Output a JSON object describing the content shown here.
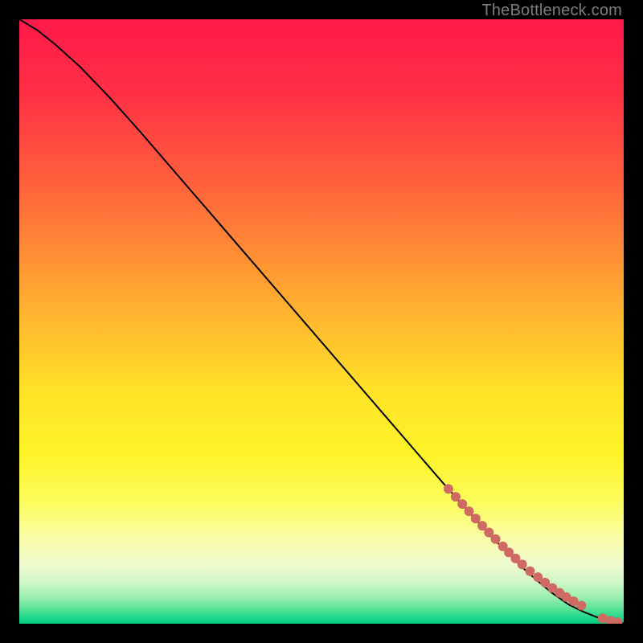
{
  "watermark": "TheBottleneck.com",
  "chart_data": {
    "type": "line",
    "title": "",
    "xlabel": "",
    "ylabel": "",
    "xlim": [
      0,
      100
    ],
    "ylim": [
      0,
      100
    ],
    "grid": false,
    "legend": false,
    "background_gradient": {
      "stops": [
        {
          "offset": 0.0,
          "color": "#ff1a49"
        },
        {
          "offset": 0.12,
          "color": "#ff2f45"
        },
        {
          "offset": 0.25,
          "color": "#ff5a3d"
        },
        {
          "offset": 0.38,
          "color": "#ff8a35"
        },
        {
          "offset": 0.5,
          "color": "#ffb92e"
        },
        {
          "offset": 0.62,
          "color": "#ffe327"
        },
        {
          "offset": 0.72,
          "color": "#fdf428"
        },
        {
          "offset": 0.8,
          "color": "#fbfc5e"
        },
        {
          "offset": 0.86,
          "color": "#f9fca8"
        },
        {
          "offset": 0.9,
          "color": "#f0fbce"
        },
        {
          "offset": 0.93,
          "color": "#d3f7c8"
        },
        {
          "offset": 0.955,
          "color": "#9eefb0"
        },
        {
          "offset": 0.975,
          "color": "#5ae49a"
        },
        {
          "offset": 0.99,
          "color": "#1fd88c"
        },
        {
          "offset": 1.0,
          "color": "#04c97e"
        }
      ]
    },
    "series": [
      {
        "name": "curve",
        "type": "line",
        "color": "#000000",
        "x": [
          0,
          3,
          6,
          10,
          15,
          20,
          30,
          40,
          50,
          60,
          70,
          78,
          84,
          88,
          91,
          93.5,
          95.5,
          97,
          98.3,
          99.3,
          100
        ],
        "y": [
          100,
          98.2,
          95.8,
          92.2,
          87.0,
          81.4,
          69.8,
          58.2,
          46.6,
          35.0,
          23.4,
          14.5,
          8.6,
          5.2,
          3.1,
          1.9,
          1.1,
          0.6,
          0.3,
          0.15,
          0.1
        ]
      },
      {
        "name": "highlight-points",
        "type": "scatter",
        "color": "#cf6a62",
        "radius": 6,
        "x": [
          71.0,
          72.2,
          73.3,
          74.4,
          75.5,
          76.6,
          77.7,
          78.8,
          80.0,
          81.0,
          82.1,
          83.2,
          84.5,
          85.8,
          87.0,
          88.2,
          89.4,
          90.5,
          91.7,
          93.0,
          96.5,
          97.8,
          99.0
        ],
        "y": [
          22.3,
          21.0,
          19.8,
          18.6,
          17.4,
          16.2,
          15.1,
          14.0,
          12.8,
          11.8,
          10.8,
          9.8,
          8.7,
          7.7,
          6.8,
          5.9,
          5.1,
          4.4,
          3.7,
          3.0,
          0.9,
          0.5,
          0.25
        ]
      }
    ]
  }
}
